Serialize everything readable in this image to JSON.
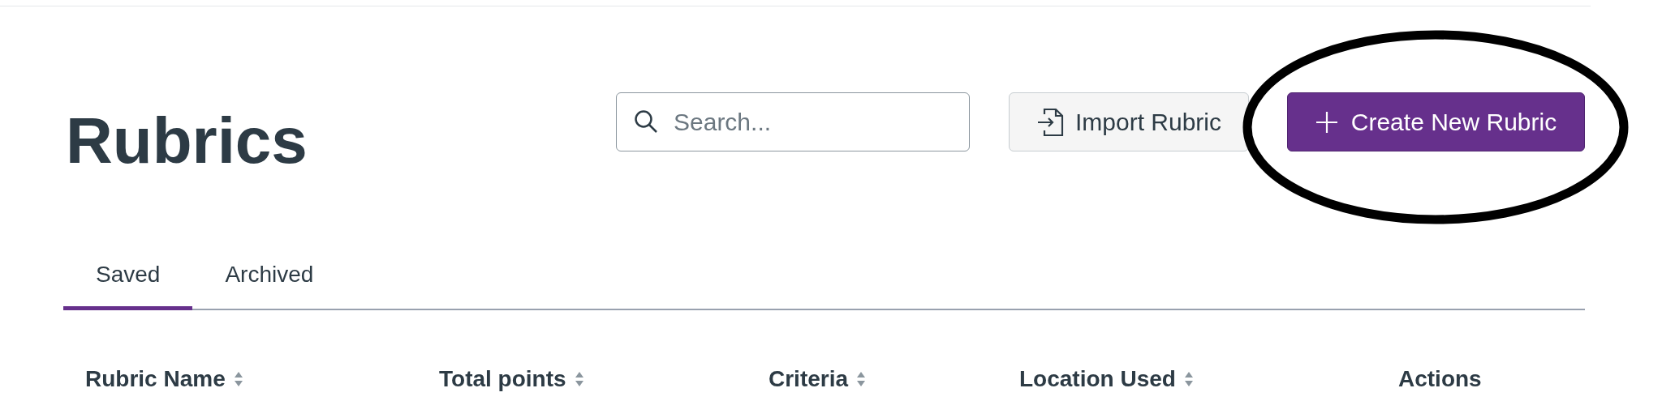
{
  "page": {
    "title": "Rubrics"
  },
  "search": {
    "placeholder": "Search..."
  },
  "buttons": [
    {
      "label": "Import Rubric",
      "kind": "secondary",
      "circled": false
    },
    {
      "label": "Create New Rubric",
      "kind": "primary",
      "circled": true
    }
  ],
  "tabs": [
    {
      "label": "Saved",
      "selected": true
    },
    {
      "label": "Archived",
      "selected": false
    }
  ],
  "table": {
    "columns": [
      {
        "label": "Rubric Name",
        "sortable": true
      },
      {
        "label": "Total points",
        "sortable": true
      },
      {
        "label": "Criteria",
        "sortable": true
      },
      {
        "label": "Location Used",
        "sortable": true
      },
      {
        "label": "Actions",
        "sortable": false
      }
    ]
  }
}
